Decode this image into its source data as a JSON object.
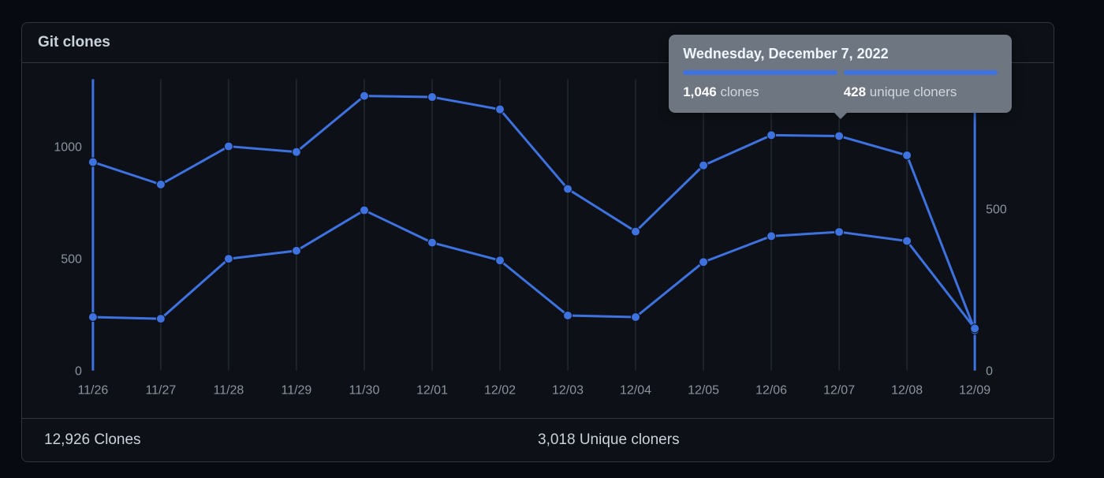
{
  "panel": {
    "title": "Git clones"
  },
  "footer": {
    "clones": "12,926 Clones",
    "unique": "3,018 Unique cloners"
  },
  "tooltip": {
    "title": "Wednesday, December 7, 2022",
    "clones_value": "1,046",
    "clones_label": " clones",
    "unique_value": "428",
    "unique_label": " unique cloners"
  },
  "chart_data": {
    "type": "line",
    "title": "Git clones",
    "xlabel": "",
    "categories": [
      "11/26",
      "11/27",
      "11/28",
      "11/29",
      "11/30",
      "12/01",
      "12/02",
      "12/03",
      "12/04",
      "12/05",
      "12/06",
      "12/07",
      "12/08",
      "12/09"
    ],
    "series": [
      {
        "name": "Clones",
        "axis": "left",
        "values": [
          930,
          830,
          1000,
          975,
          1225,
          1220,
          1165,
          810,
          620,
          915,
          1050,
          1046,
          960,
          180
        ]
      },
      {
        "name": "Unique cloners",
        "axis": "right",
        "values": [
          165,
          160,
          345,
          370,
          495,
          395,
          340,
          170,
          165,
          335,
          415,
          428,
          400,
          130
        ]
      }
    ],
    "y_left": {
      "label": "",
      "ticks": [
        0,
        500,
        1000
      ],
      "range": [
        0,
        1300
      ]
    },
    "y_right": {
      "label": "",
      "ticks": [
        0,
        500
      ],
      "range": [
        0,
        900
      ]
    },
    "grid": true,
    "legend": false,
    "highlight_index": 11
  }
}
